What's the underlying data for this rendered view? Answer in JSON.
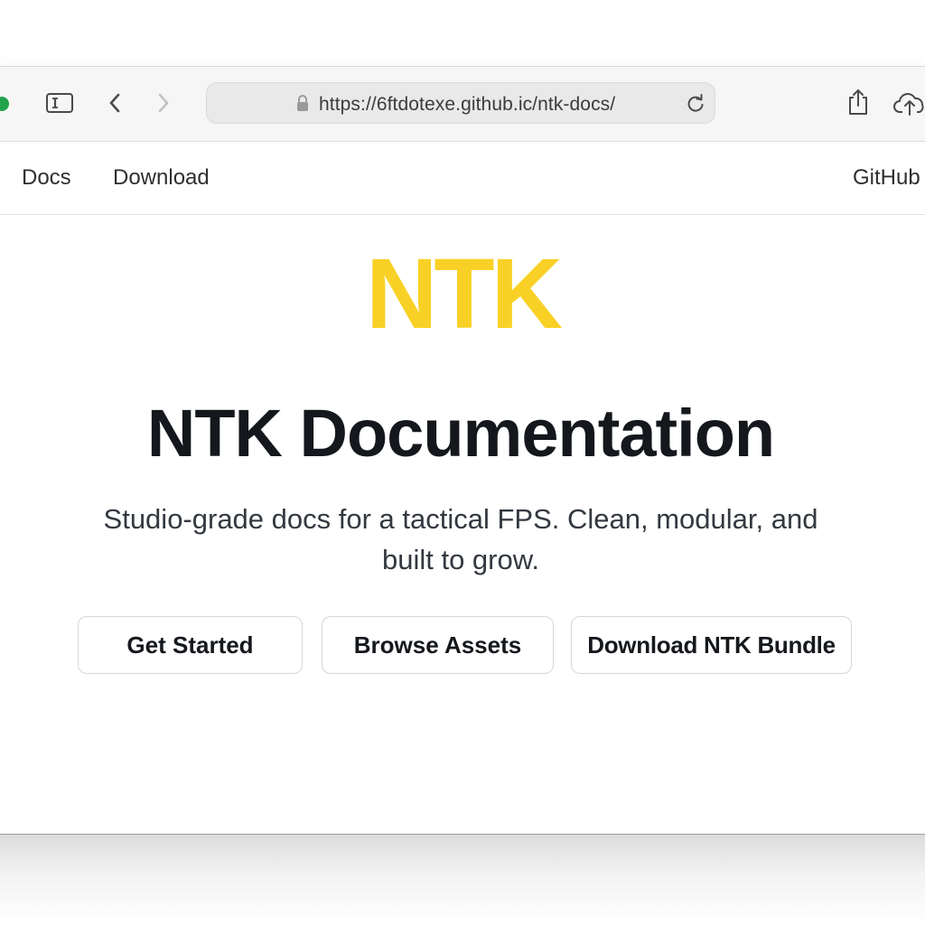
{
  "browser": {
    "url": "https://6ftdotexe.github.ic/ntk-docs/",
    "icons": {
      "sidebar": "sidebar-toggle-icon",
      "back": "chevron-left-icon",
      "forward": "chevron-right-icon",
      "lock": "lock-icon",
      "reload": "reload-icon",
      "share": "share-icon",
      "cloud": "cloud-upload-icon"
    },
    "traffic_light_color": "#22a24a"
  },
  "nav": {
    "links": [
      {
        "label": "Docs"
      },
      {
        "label": "Download"
      }
    ],
    "github_label": "GitHub"
  },
  "hero": {
    "logo_text": "NTK",
    "logo_color": "#f9d126",
    "title": "NTK Documentation",
    "subtitle": "Studio-grade docs for a tactical FPS. Clean, modular, and built to grow."
  },
  "actions": {
    "get_started": "Get Started",
    "browse_assets": "Browse Assets",
    "download_bundle": "Download NTK Bundle"
  }
}
